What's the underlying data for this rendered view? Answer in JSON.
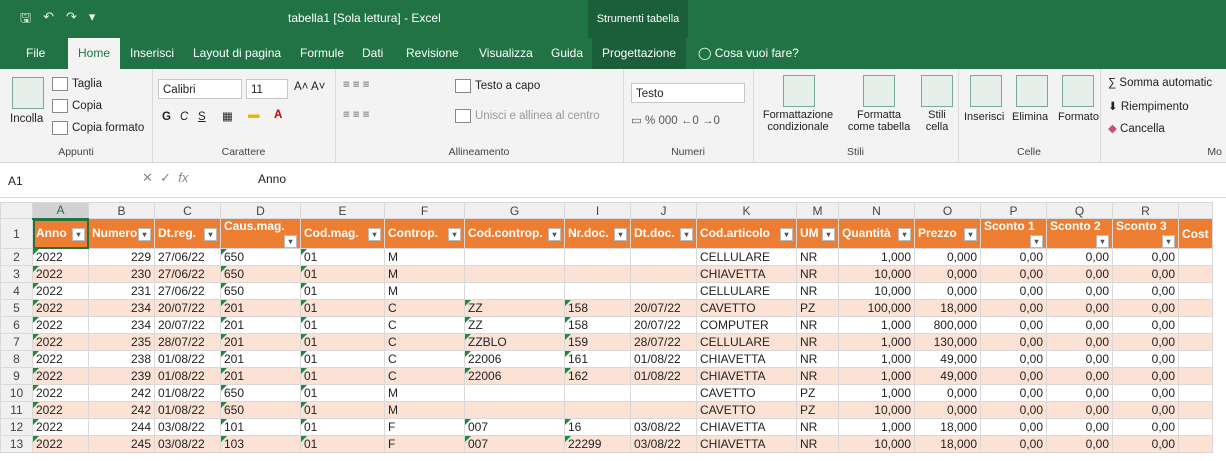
{
  "window": {
    "title": "tabella1  [Sola lettura]  -  Excel",
    "tool_context": "Strumenti tabella"
  },
  "tabs": [
    "File",
    "Home",
    "Inserisci",
    "Layout di pagina",
    "Formule",
    "Dati",
    "Revisione",
    "Visualizza",
    "Guida",
    "Progettazione",
    "Cosa vuoi fare?"
  ],
  "ribbon": {
    "clipboard": {
      "paste": "Incolla",
      "cut": "Taglia",
      "copy": "Copia",
      "format_painter": "Copia formato",
      "label": "Appunti"
    },
    "font": {
      "name": "Calibri",
      "size": "11",
      "bold": "G",
      "italic": "C",
      "underline": "S",
      "label": "Carattere"
    },
    "alignment": {
      "wrap": "Testo a capo",
      "merge": "Unisci e allinea al centro",
      "label": "Allineamento"
    },
    "number": {
      "format": "Testo",
      "label": "Numeri"
    },
    "styles": {
      "conditional": "Formattazione condizionale",
      "table": "Formatta come tabella",
      "cell": "Stili cella",
      "label": "Stili"
    },
    "cells": {
      "insert": "Inserisci",
      "delete": "Elimina",
      "format": "Formato",
      "label": "Celle"
    },
    "editing": {
      "autosum": "Somma automatic",
      "fill": "Riempimento",
      "clear": "Cancella",
      "label": "Mo"
    }
  },
  "formula_bar": {
    "name_box": "A1",
    "fx": "fx",
    "value": "Anno"
  },
  "columns": [
    "A",
    "B",
    "C",
    "D",
    "E",
    "F",
    "G",
    "I",
    "J",
    "K",
    "M",
    "N",
    "O",
    "P",
    "Q",
    "R"
  ],
  "headers": [
    "Anno",
    "Numero",
    "Dt.reg.",
    "Caus.mag.",
    "Cod.mag.",
    "Controp.",
    "Cod.controp.",
    "Nr.doc.",
    "Dt.doc.",
    "Cod.articolo",
    "UM",
    "Quantità",
    "Prezzo",
    "Sconto 1",
    "Sconto 2",
    "Sconto 3",
    "Cost"
  ],
  "rows": [
    [
      "2022",
      "229",
      "27/06/22",
      "650",
      "01",
      "M",
      "",
      "",
      "",
      "CELLULARE",
      "NR",
      "1,000",
      "0,000",
      "0,00",
      "0,00",
      "0,00"
    ],
    [
      "2022",
      "230",
      "27/06/22",
      "650",
      "01",
      "M",
      "",
      "",
      "",
      "CHIAVETTA",
      "NR",
      "10,000",
      "0,000",
      "0,00",
      "0,00",
      "0,00"
    ],
    [
      "2022",
      "231",
      "27/06/22",
      "650",
      "01",
      "M",
      "",
      "",
      "",
      "CELLULARE",
      "NR",
      "10,000",
      "0,000",
      "0,00",
      "0,00",
      "0,00"
    ],
    [
      "2022",
      "234",
      "20/07/22",
      "201",
      "01",
      "C",
      "ZZ",
      "158",
      "20/07/22",
      "CAVETTO",
      "PZ",
      "100,000",
      "18,000",
      "0,00",
      "0,00",
      "0,00"
    ],
    [
      "2022",
      "234",
      "20/07/22",
      "201",
      "01",
      "C",
      "ZZ",
      "158",
      "20/07/22",
      "COMPUTER",
      "NR",
      "1,000",
      "800,000",
      "0,00",
      "0,00",
      "0,00"
    ],
    [
      "2022",
      "235",
      "28/07/22",
      "201",
      "01",
      "C",
      "ZZBLO",
      "159",
      "28/07/22",
      "CELLULARE",
      "NR",
      "1,000",
      "130,000",
      "0,00",
      "0,00",
      "0,00"
    ],
    [
      "2022",
      "238",
      "01/08/22",
      "201",
      "01",
      "C",
      "22006",
      "161",
      "01/08/22",
      "CHIAVETTA",
      "NR",
      "1,000",
      "49,000",
      "0,00",
      "0,00",
      "0,00"
    ],
    [
      "2022",
      "239",
      "01/08/22",
      "201",
      "01",
      "C",
      "22006",
      "162",
      "01/08/22",
      "CHIAVETTA",
      "NR",
      "1,000",
      "49,000",
      "0,00",
      "0,00",
      "0,00"
    ],
    [
      "2022",
      "242",
      "01/08/22",
      "650",
      "01",
      "M",
      "",
      "",
      "",
      "CAVETTO",
      "PZ",
      "1,000",
      "0,000",
      "0,00",
      "0,00",
      "0,00"
    ],
    [
      "2022",
      "242",
      "01/08/22",
      "650",
      "01",
      "M",
      "",
      "",
      "",
      "CAVETTO",
      "PZ",
      "10,000",
      "0,000",
      "0,00",
      "0,00",
      "0,00"
    ],
    [
      "2022",
      "244",
      "03/08/22",
      "101",
      "01",
      "F",
      "007",
      "16",
      "03/08/22",
      "CHIAVETTA",
      "NR",
      "1,000",
      "18,000",
      "0,00",
      "0,00",
      "0,00"
    ],
    [
      "2022",
      "245",
      "03/08/22",
      "103",
      "01",
      "F",
      "007",
      "22299",
      "03/08/22",
      "CHIAVETTA",
      "NR",
      "10,000",
      "18,000",
      "0,00",
      "0,00",
      "0,00"
    ]
  ],
  "colors": {
    "excel_green": "#217346",
    "header_orange": "#ed7d31",
    "band_peach": "#fbe2d5"
  }
}
